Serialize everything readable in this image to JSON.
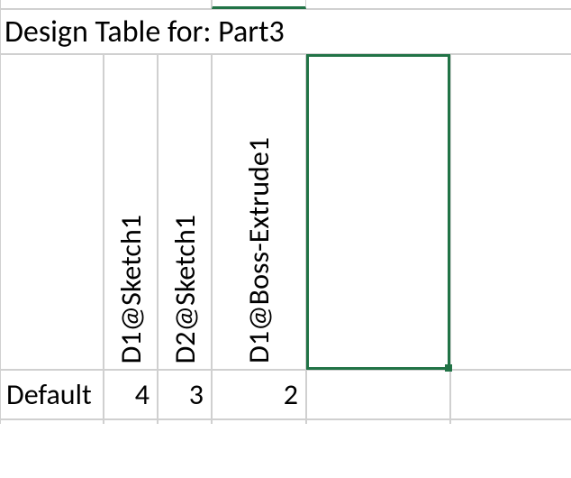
{
  "title": "Design Table for: Part3",
  "columns": [
    "D1@Sketch1",
    "D2@Sketch1",
    "D1@Boss-Extrude1"
  ],
  "rows": [
    {
      "label": "Default",
      "values": [
        4,
        3,
        2
      ]
    }
  ],
  "colors": {
    "selection": "#217346",
    "grid": "#d0d0d0"
  }
}
